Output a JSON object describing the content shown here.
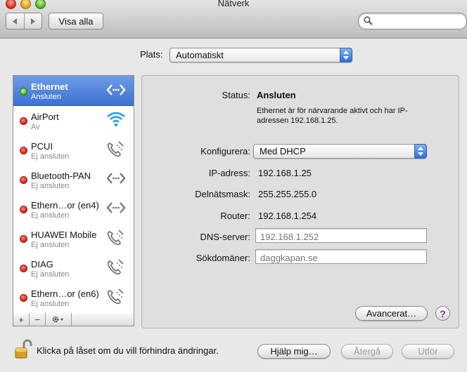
{
  "window": {
    "title": "Nätverk"
  },
  "toolbar": {
    "show_all_label": "Visa alla",
    "search_placeholder": ""
  },
  "location": {
    "label": "Plats:",
    "value": "Automatiskt"
  },
  "services": [
    {
      "name": "Ethernet",
      "status": "Ansluten",
      "state": "green",
      "icon": "ethernet-arrows-icon",
      "selected": true
    },
    {
      "name": "AirPort",
      "status": "Av",
      "state": "red",
      "icon": "wifi-icon",
      "selected": false
    },
    {
      "name": "PCUI",
      "status": "Ej ansluten",
      "state": "red",
      "icon": "phone-icon",
      "selected": false
    },
    {
      "name": "Bluetooth-PAN",
      "status": "Ej ansluten",
      "state": "red",
      "icon": "ethernet-arrows-icon",
      "selected": false
    },
    {
      "name": "Ethern…or (en4)",
      "status": "Ej ansluten",
      "state": "red",
      "icon": "ethernet-arrows-icon",
      "selected": false
    },
    {
      "name": "HUAWEI Mobile",
      "status": "Ej ansluten",
      "state": "red",
      "icon": "phone-icon",
      "selected": false
    },
    {
      "name": "DIAG",
      "status": "Ej ansluten",
      "state": "red",
      "icon": "phone-icon",
      "selected": false
    },
    {
      "name": "Ethern…or (en6)",
      "status": "Ej ansluten",
      "state": "red",
      "icon": "phone-icon",
      "selected": false
    }
  ],
  "sidebar_buttons": {
    "add": "+",
    "remove": "−"
  },
  "detail": {
    "status_label": "Status:",
    "status_value": "Ansluten",
    "status_desc_line1": "Ethernet är för närvarande aktivt och har IP-",
    "status_desc_line2": "adressen 192.168.1.25.",
    "configure_label": "Konfigurera:",
    "configure_value": "Med DHCP",
    "ip_label": "IP-adress:",
    "ip_value": "192.168.1.25",
    "subnet_label": "Delnätsmask:",
    "subnet_value": "255.255.255.0",
    "router_label": "Router:",
    "router_value": "192.168.1.254",
    "dns_label": "DNS-server:",
    "dns_placeholder": "192.168.1.252",
    "search_domains_label": "Sökdomäner:",
    "search_domains_placeholder": "daggkapan.se",
    "advanced_label": "Avancerat…",
    "help_label": "?"
  },
  "footer": {
    "lock_text": "Klicka på låset om du vill förhindra ändringar.",
    "help_button": "Hjälp mig…",
    "revert_button": "Återgå",
    "apply_button": "Utför"
  },
  "colors": {
    "selection": "#3d72d4",
    "status_connected": "#3fb81a",
    "status_disconnected": "#dc1c0c"
  }
}
